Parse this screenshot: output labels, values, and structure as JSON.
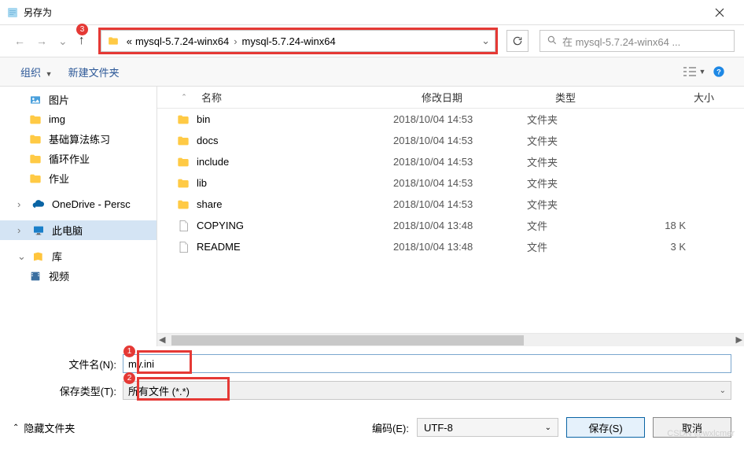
{
  "title": "另存为",
  "annot": {
    "a1": "1",
    "a2": "2",
    "a3": "3"
  },
  "path": {
    "seg1": "mysql-5.7.24-winx64",
    "seg2": "mysql-5.7.24-winx64",
    "chevron": "«"
  },
  "search": {
    "placeholder": "在 mysql-5.7.24-winx64 ..."
  },
  "toolbar": {
    "organize": "组织",
    "new_folder": "新建文件夹"
  },
  "columns": {
    "name": "名称",
    "date": "修改日期",
    "type": "类型",
    "size": "大小"
  },
  "sidebar": {
    "items": [
      {
        "label": "图片",
        "icon": "picture"
      },
      {
        "label": "img",
        "icon": "folder"
      },
      {
        "label": "基础算法练习",
        "icon": "folder"
      },
      {
        "label": "循环作业",
        "icon": "folder"
      },
      {
        "label": "作业",
        "icon": "folder"
      }
    ],
    "onedrive": "OneDrive - Persc",
    "thispc": "此电脑",
    "library": "库",
    "videos": "视频"
  },
  "files": [
    {
      "name": "bin",
      "date": "2018/10/04 14:53",
      "type": "文件夹",
      "size": "",
      "icon": "folder"
    },
    {
      "name": "docs",
      "date": "2018/10/04 14:53",
      "type": "文件夹",
      "size": "",
      "icon": "folder"
    },
    {
      "name": "include",
      "date": "2018/10/04 14:53",
      "type": "文件夹",
      "size": "",
      "icon": "folder"
    },
    {
      "name": "lib",
      "date": "2018/10/04 14:53",
      "type": "文件夹",
      "size": "",
      "icon": "folder"
    },
    {
      "name": "share",
      "date": "2018/10/04 14:53",
      "type": "文件夹",
      "size": "",
      "icon": "folder"
    },
    {
      "name": "COPYING",
      "date": "2018/10/04 13:48",
      "type": "文件",
      "size": "18 K",
      "icon": "file"
    },
    {
      "name": "README",
      "date": "2018/10/04 13:48",
      "type": "文件",
      "size": "3 K",
      "icon": "file"
    }
  ],
  "form": {
    "filename_label": "文件名(N):",
    "filename_value": "my.ini",
    "filetype_label": "保存类型(T):",
    "filetype_value": "所有文件 (*.*)"
  },
  "footer": {
    "hide_folders": "隐藏文件夹",
    "encoding_label": "编码(E):",
    "encoding_value": "UTF-8",
    "save": "保存(S)",
    "cancel": "取消"
  },
  "watermark": "CSDN @wxlcmer"
}
